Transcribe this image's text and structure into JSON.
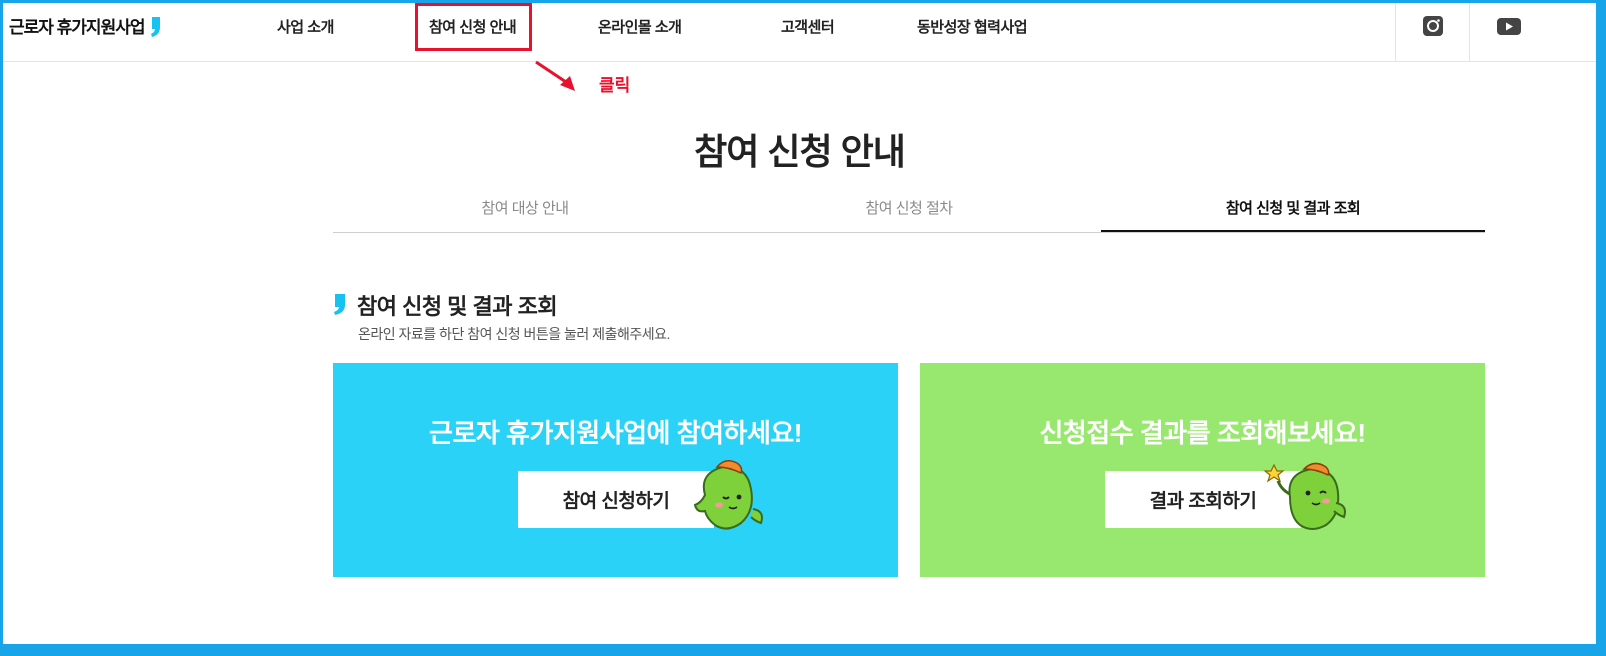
{
  "header": {
    "logo_text": "근로자 휴가지원사업",
    "nav": [
      "사업 소개",
      "참여 신청 안내",
      "온라인몰 소개",
      "고객센터",
      "동반성장 협력사업"
    ]
  },
  "annotation": {
    "click_label": "클릭",
    "color": "#e8112e"
  },
  "main": {
    "title": "참여 신청 안내",
    "tabs": [
      "참여 대상 안내",
      "참여 신청 절차",
      "참여 신청 및 결과 조회"
    ],
    "active_tab": "참여 신청 및 결과 조회",
    "section_title": "참여 신청 및 결과 조회",
    "section_desc": "온라인 자료를 하단 참여 신청 버튼을 눌러 제출해주세요."
  },
  "cards": [
    {
      "heading": "근로자 휴가지원사업에 참여하세요!",
      "button": "참여 신청하기",
      "color": "#2bd2f8"
    },
    {
      "heading": "신청접수 결과를 조회해보세요!",
      "button": "결과 조회하기",
      "color": "#98e870"
    }
  ],
  "icons": [
    "instagram-icon",
    "youtube-icon",
    "quote-mark-icon",
    "mascot-icon"
  ],
  "colors": {
    "accent_blue": "#2bd2f8",
    "accent_green": "#98e870",
    "frame": "#18a4e8",
    "highlight": "#e8112e"
  }
}
